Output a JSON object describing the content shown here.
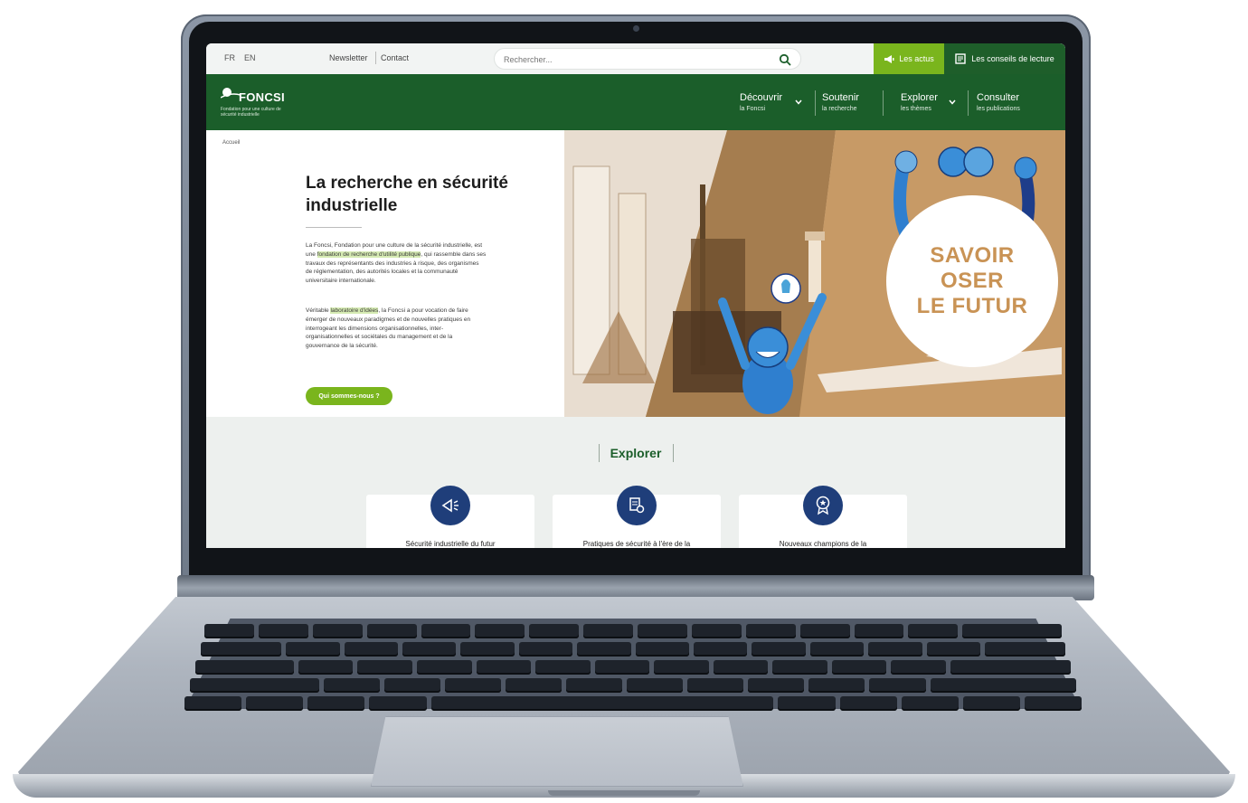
{
  "topbar": {
    "lang_fr": "FR",
    "lang_en": "EN",
    "newsletter": "Newsletter",
    "contact": "Contact",
    "search_placeholder": "Rechercher...",
    "actus_label": "Les actus",
    "conseils_label": "Les conseils de lecture"
  },
  "logo": {
    "name": "FONCSI",
    "tagline": "Fondation pour une culture de sécurité industrielle"
  },
  "nav": [
    {
      "title": "Découvrir",
      "sub": "la Foncsi"
    },
    {
      "title": "Soutenir",
      "sub": "la recherche"
    },
    {
      "title": "Explorer",
      "sub": "les thèmes"
    },
    {
      "title": "Consulter",
      "sub": "les publications"
    }
  ],
  "breadcrumb": "Accueil",
  "hero": {
    "title": "La recherche en sécurité industrielle",
    "p1_a": "La Foncsi, Fondation pour une culture de la sécurité industrielle, est une ",
    "p1_hl": "fondation de recherche d'utilité publique",
    "p1_b": ", qui rassemble dans ses travaux des représentants des industries à risque, des organismes de réglementation, des autorités locales et la communauté universitaire internationale.",
    "p2_a": "Véritable ",
    "p2_hl": "laboratoire d'idées",
    "p2_b": ", la Foncsi a pour vocation de faire émerger de nouveaux paradigmes et de nouvelles pratiques en interrogeant les dimensions organisationnelles, inter-organisationnelles et sociétales du management et de la gouvernance de la sécurité.",
    "button": "Qui sommes-nous ?",
    "badge_line1": "SAVOIR",
    "badge_line2": "OSER",
    "badge_line3": "LE FUTUR"
  },
  "explore": {
    "title": "Explorer",
    "cards": [
      {
        "label": "Sécurité industrielle du futur",
        "icon": "megaphone-icon"
      },
      {
        "label": "Pratiques de sécurité à l'ère de la",
        "icon": "document-gear-icon"
      },
      {
        "label": "Nouveaux champions de la",
        "icon": "award-medal-icon"
      }
    ]
  },
  "colors": {
    "nav_green": "#1b5e2a",
    "accent_green": "#7ab51d",
    "icon_blue": "#1f3e7a",
    "badge_gold": "#c99355"
  }
}
